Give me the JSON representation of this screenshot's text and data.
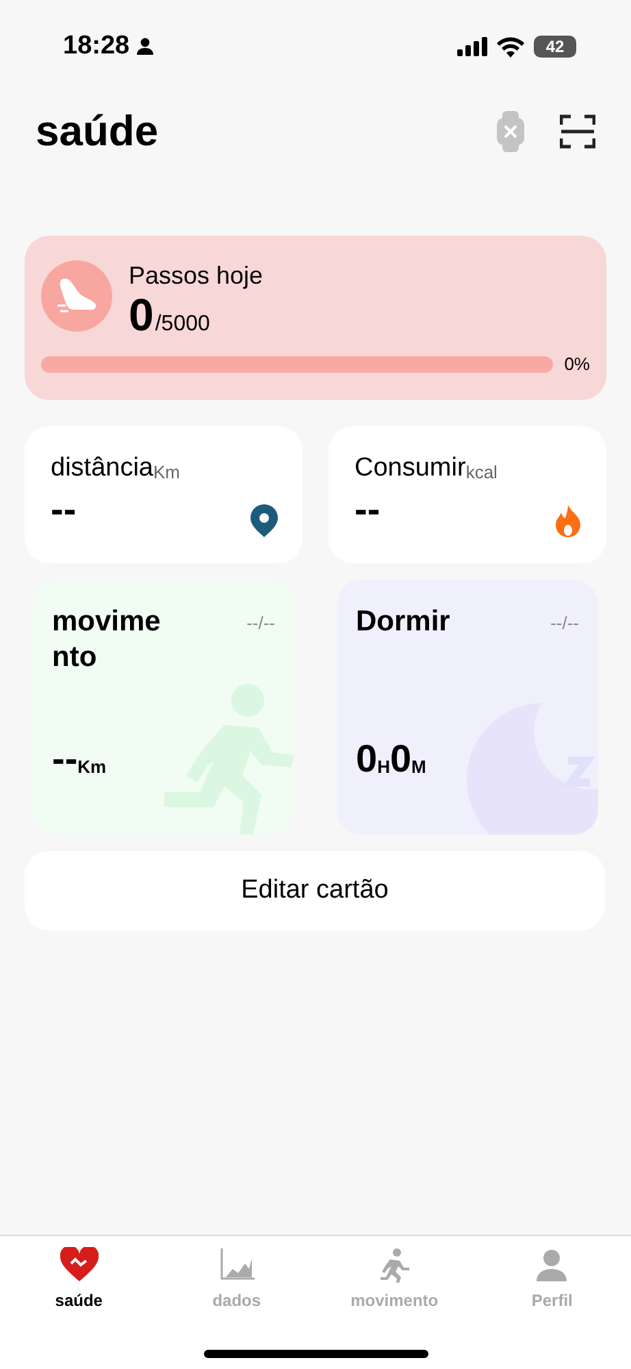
{
  "status_bar": {
    "time": "18:28",
    "battery": "42"
  },
  "header": {
    "title": "saúde"
  },
  "steps_card": {
    "title": "Passos hoje",
    "value": "0",
    "goal": "/5000",
    "level": 0,
    "percent": "0%"
  },
  "stat_cards": [
    {
      "kind": "distance",
      "label": "distância",
      "unit": "Km",
      "value": "--"
    },
    {
      "kind": "calories",
      "label": "Consumir",
      "unit": "kcal",
      "value": "--"
    }
  ],
  "activity_cards": [
    {
      "kind": "movement",
      "title": "movimento",
      "date": "--/--",
      "value": "--",
      "unit": "Km"
    },
    {
      "kind": "sleep",
      "title": "Dormir",
      "date": "--/--",
      "hours": "0",
      "hours_unit": "H",
      "minutes": "0",
      "minutes_unit": "M"
    }
  ],
  "edit_button": "Editar cartão",
  "tabs": [
    {
      "kind": "health",
      "label": "saúde",
      "selected": true
    },
    {
      "kind": "data",
      "label": "dados",
      "selected": false
    },
    {
      "kind": "movement",
      "label": "movimento",
      "selected": false
    },
    {
      "kind": "profile",
      "label": "Perfil",
      "selected": false
    }
  ]
}
